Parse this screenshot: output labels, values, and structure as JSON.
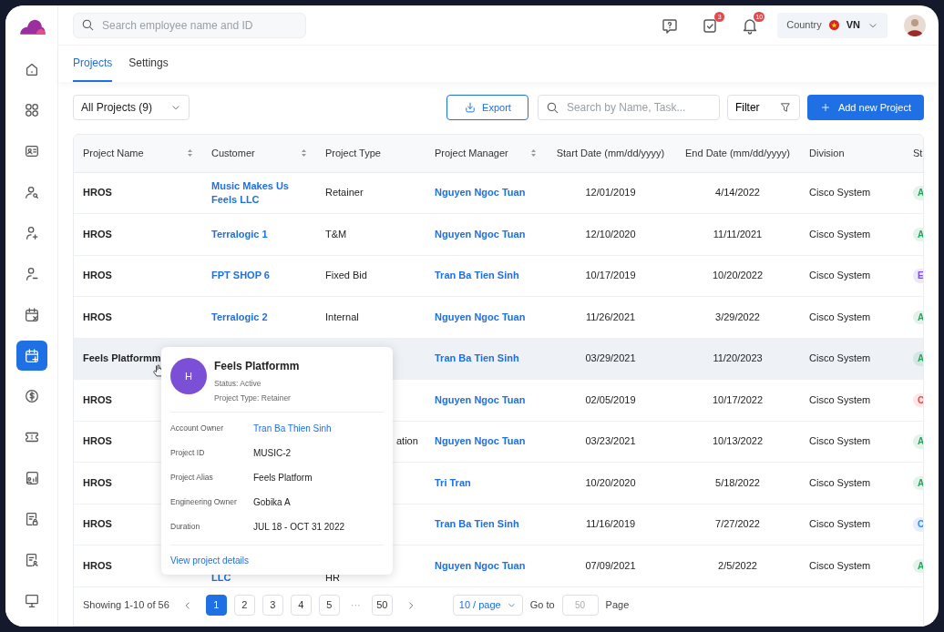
{
  "sidebar": {
    "items": [
      {
        "kind": "home",
        "selected": false
      },
      {
        "kind": "apps",
        "selected": false
      },
      {
        "kind": "idcard",
        "selected": false
      },
      {
        "kind": "usersearch",
        "selected": false
      },
      {
        "kind": "userplus",
        "selected": false
      },
      {
        "kind": "userminus",
        "selected": false
      },
      {
        "kind": "calx",
        "selected": false
      },
      {
        "kind": "calplus",
        "selected": true
      },
      {
        "kind": "dollar",
        "selected": false
      },
      {
        "kind": "ticket",
        "selected": false
      },
      {
        "kind": "chart",
        "selected": false
      },
      {
        "kind": "doclock",
        "selected": false
      },
      {
        "kind": "docuser",
        "selected": false
      },
      {
        "kind": "monitor",
        "selected": false
      }
    ]
  },
  "header": {
    "search": {
      "placeholder": "Search employee name and ID"
    },
    "notifications": [
      {
        "kind": "help"
      },
      {
        "kind": "tasks",
        "count": "3"
      },
      {
        "kind": "bell",
        "count": "10"
      }
    ],
    "country": {
      "label": "Country",
      "value": "VN"
    }
  },
  "tabs": [
    {
      "label": "Projects",
      "selected": true
    },
    {
      "label": "Settings",
      "selected": false
    }
  ],
  "toolbar": {
    "filter_select": "All Projects (9)",
    "export": "Export",
    "search": {
      "placeholder": "Search by Name, Task..."
    },
    "filter": "Filter",
    "add": "Add new Project"
  },
  "table": {
    "columns": [
      {
        "label": "Project Name",
        "sortable": true
      },
      {
        "label": "Customer",
        "sortable": true
      },
      {
        "label": "Project Type",
        "sortable": false
      },
      {
        "label": "Project Manager",
        "sortable": true
      },
      {
        "label": "Start Date (mm/dd/yyyy)",
        "sortable": false
      },
      {
        "label": "End Date (mm/dd/yyyy)",
        "sortable": false
      },
      {
        "label": "Division",
        "sortable": false
      },
      {
        "label": "St"
      }
    ],
    "rows": [
      {
        "name": "HROS",
        "customer": "Music Makes Us Feels LLC",
        "type": "Retainer",
        "manager": "Nguyen Ngoc Tuan",
        "start": "12/01/2019",
        "end": "4/14/2022",
        "division": "Cisco System",
        "status": {
          "text": "A",
          "color": "#22a55b"
        },
        "hovered": false
      },
      {
        "name": "HROS",
        "customer": "Terralogic 1",
        "type": "T&M",
        "manager": "Nguyen Ngoc Tuan",
        "start": "12/10/2020",
        "end": "11/11/2021",
        "division": "Cisco System",
        "status": {
          "text": "A",
          "color": "#22a55b"
        },
        "hovered": false
      },
      {
        "name": "HROS",
        "customer": "FPT SHOP 6",
        "type": "Fixed Bid",
        "manager": "Tran  Ba Tien Sinh",
        "start": "10/17/2019",
        "end": "10/20/2022",
        "division": "Cisco System",
        "status": {
          "text": "E",
          "color": "#7c4dda"
        },
        "hovered": false
      },
      {
        "name": "HROS",
        "customer": "Terralogic 2",
        "type": "Internal",
        "manager": "Nguyen Ngoc Tuan",
        "start": "11/26/2021",
        "end": "3/29/2022",
        "division": "Cisco System",
        "status": {
          "text": "A",
          "color": "#22a55b"
        },
        "hovered": false
      },
      {
        "name": "Feels Platformm",
        "manager": "Tran  Ba Tien Sinh",
        "start": "03/29/2021",
        "end": "11/20/2023",
        "division": "Cisco System",
        "status": {
          "text": "A",
          "color": "#22a55b"
        },
        "hovered": true
      },
      {
        "name": "HROS",
        "manager": "Nguyen Ngoc Tuan",
        "start": "02/05/2019",
        "end": "10/17/2022",
        "division": "Cisco System",
        "status": {
          "text": "C",
          "color": "#e5484d"
        },
        "hovered": false
      },
      {
        "name": "HROS",
        "type_tail": "ation",
        "manager": "Nguyen Ngoc Tuan",
        "start": "03/23/2021",
        "end": "10/13/2022",
        "division": "Cisco System",
        "status": {
          "text": "A",
          "color": "#22a55b"
        },
        "hovered": false
      },
      {
        "name": "HROS",
        "manager": "Tri Tran",
        "start": "10/20/2020",
        "end": "5/18/2022",
        "division": "Cisco System",
        "status": {
          "text": "A",
          "color": "#22a55b"
        },
        "hovered": false
      },
      {
        "name": "HROS",
        "manager": "Tran  Ba Tien Sinh",
        "start": "11/16/2019",
        "end": "7/27/2022",
        "division": "Cisco System",
        "status": {
          "text": "C",
          "color": "#3b82f6"
        },
        "hovered": false
      },
      {
        "name": "HROS",
        "customer_tail": "LLC",
        "type": "HR",
        "manager": "Nguyen Ngoc Tuan",
        "start": "07/09/2021",
        "end": "2/5/2022",
        "division": "Cisco System",
        "status": {
          "text": "A",
          "color": "#22a55b"
        },
        "hovered": false
      }
    ]
  },
  "popover": {
    "initial": "H",
    "title": "Feels Platformm",
    "status": "Status: Active",
    "type": "Project Type: Retainer",
    "fields": [
      {
        "label": "Account Owner",
        "value": "Tran Ba Thien Sinh",
        "kind": "link"
      },
      {
        "label": "Project ID",
        "value": "MUSIC-2",
        "kind": "text"
      },
      {
        "label": "Project Alias",
        "value": "Feels Platform",
        "kind": "text"
      },
      {
        "label": "Engineering Owner",
        "value": "Gobika A",
        "kind": "text"
      },
      {
        "label": "Duration",
        "value": "JUL 18 - OCT 31 2022",
        "kind": "text"
      }
    ],
    "link": "View project details"
  },
  "pagination": {
    "summary": "Showing 1-10 of 56",
    "pages": [
      {
        "label": "1",
        "selected": true
      },
      {
        "label": "2",
        "selected": false
      },
      {
        "label": "3",
        "selected": false
      },
      {
        "label": "4",
        "selected": false
      },
      {
        "label": "5",
        "selected": false
      }
    ],
    "ellipsis": "···",
    "last": "50",
    "per_page": "10 / page",
    "goto_label": "Go to",
    "goto": {
      "placeholder": "50"
    },
    "page_label": "Page"
  }
}
